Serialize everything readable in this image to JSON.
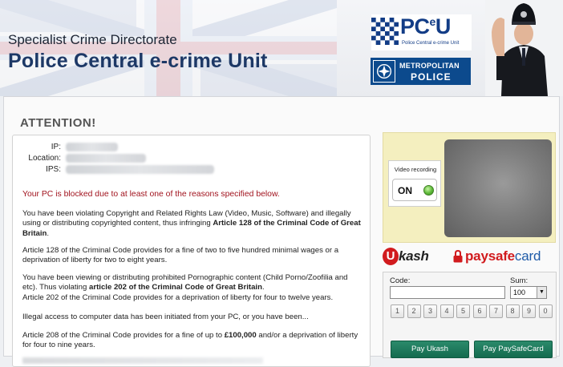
{
  "header": {
    "subtitle": "Specialist Crime Directorate",
    "title": "Police Central e-crime Unit",
    "pceu_logo": {
      "text_main": "PC",
      "text_sup": "e",
      "text_end": "U",
      "subtext": "Police Central e-crime Unit"
    },
    "met_logo": {
      "line1": "METROPOLITAN",
      "line2": "POLICE"
    }
  },
  "main": {
    "heading": "ATTENTION!",
    "info": [
      {
        "label": "IP:"
      },
      {
        "label": "Location:"
      },
      {
        "label": "IPS:"
      }
    ],
    "alert": "Your PC is blocked due to at least one of the reasons specified below.",
    "p1_text": "You have been violating Copyright and Related Rights Law (Video, Music, Software) and illegally using or distributing copyrighted content, thus infringing ",
    "p1_bold": "Article 128 of the Criminal Code of Great Britain",
    "p1_end": ".",
    "p2": "Article 128 of the Criminal Code provides for a fine of two to five hundred minimal wages or a deprivation of liberty for two to eight years.",
    "p3_text": "You have been viewing or distributing prohibited Pornographic content (Child Porno/Zoofilia and etc). Thus violating ",
    "p3_bold": "article 202 of the Criminal Code of Great Britain",
    "p3_end": ".",
    "p3_line2": "Article 202 of the Criminal Code provides for a deprivation of liberty for four to twelve years.",
    "p4": "Illegal access to computer data has been initiated from your PC, or you have been...",
    "p5_text": "Article 208 of the Criminal Code provides for a fine of up to ",
    "p5_bold": "£100,000",
    "p5_end": " and/or a deprivation of liberty for four to nine years."
  },
  "video": {
    "label": "Video recording",
    "status": "ON",
    "led_color": "#5db938"
  },
  "payment": {
    "ukash_u": "U",
    "ukash_text": "kash",
    "psc_bold": "paysafe",
    "psc_lite": "card",
    "code_label": "Code:",
    "code_value": "",
    "sum_label": "Sum:",
    "sum_value": "100",
    "keys": [
      "1",
      "2",
      "3",
      "4",
      "5",
      "6",
      "7",
      "8",
      "9",
      "0"
    ],
    "pay_ukash": "Pay Ukash",
    "pay_psc": "Pay PaySafeCard",
    "button_color": "#146b4f"
  }
}
